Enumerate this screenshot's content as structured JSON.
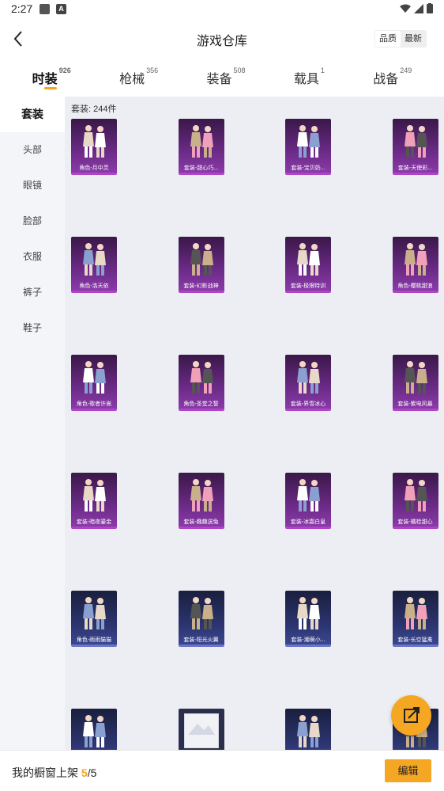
{
  "status": {
    "time": "2:27",
    "notif_icon": "A"
  },
  "header": {
    "title": "游戏仓库",
    "sort_options": [
      "品质",
      "最新"
    ]
  },
  "tabs": [
    {
      "label": "时装",
      "count": "926"
    },
    {
      "label": "枪械",
      "count": "356"
    },
    {
      "label": "装备",
      "count": "508"
    },
    {
      "label": "载具",
      "count": "1"
    },
    {
      "label": "战备",
      "count": "249"
    }
  ],
  "sidebar": {
    "items": [
      "套装",
      "头部",
      "眼镜",
      "脸部",
      "衣服",
      "裤子",
      "鞋子"
    ]
  },
  "content": {
    "count_label": "套装: 244件",
    "items": [
      {
        "name": "角色-月中灵",
        "rarity": "purple"
      },
      {
        "name": "套装-甜心巧...",
        "rarity": "purple"
      },
      {
        "name": "套装-宝贝奶...",
        "rarity": "purple"
      },
      {
        "name": "套装-天使彩...",
        "rarity": "purple"
      },
      {
        "name": "角色-洛天依",
        "rarity": "purple"
      },
      {
        "name": "套装-幻影战神",
        "rarity": "purple"
      },
      {
        "name": "套装-极限特训",
        "rarity": "purple"
      },
      {
        "name": "角色-樱桃甜浪",
        "rarity": "purple"
      },
      {
        "name": "角色-歌者许嵩",
        "rarity": "purple"
      },
      {
        "name": "角色-圣堂之誓",
        "rarity": "purple"
      },
      {
        "name": "套装-界雪冰心",
        "rarity": "purple"
      },
      {
        "name": "套装-紫电风暴",
        "rarity": "purple"
      },
      {
        "name": "套装-暗夜鎏金",
        "rarity": "purple"
      },
      {
        "name": "套装-趣趣送兔",
        "rarity": "purple"
      },
      {
        "name": "套装-冰霜白皇",
        "rarity": "purple"
      },
      {
        "name": "套装-橘桂甜心",
        "rarity": "purple"
      },
      {
        "name": "角色-雨雨猫猫",
        "rarity": "blue"
      },
      {
        "name": "套装-阳光火翼",
        "rarity": "blue"
      },
      {
        "name": "套装-潮萌小...",
        "rarity": "blue"
      },
      {
        "name": "套装-长空猛禽",
        "rarity": "blue"
      },
      {
        "name": "",
        "rarity": "blue"
      },
      {
        "name": "",
        "rarity": "plain",
        "placeholder": "image"
      },
      {
        "name": "",
        "rarity": "blue"
      },
      {
        "name": "",
        "rarity": "blue"
      }
    ]
  },
  "fab": {
    "icon": "share-out-icon"
  },
  "bottom": {
    "label": "我的橱窗上架",
    "current": "5",
    "total": "/5",
    "edit_label": "编辑"
  },
  "colors": {
    "accent": "#f5a623",
    "purple_card": "#6a2a86",
    "blue_card": "#2c3570"
  }
}
